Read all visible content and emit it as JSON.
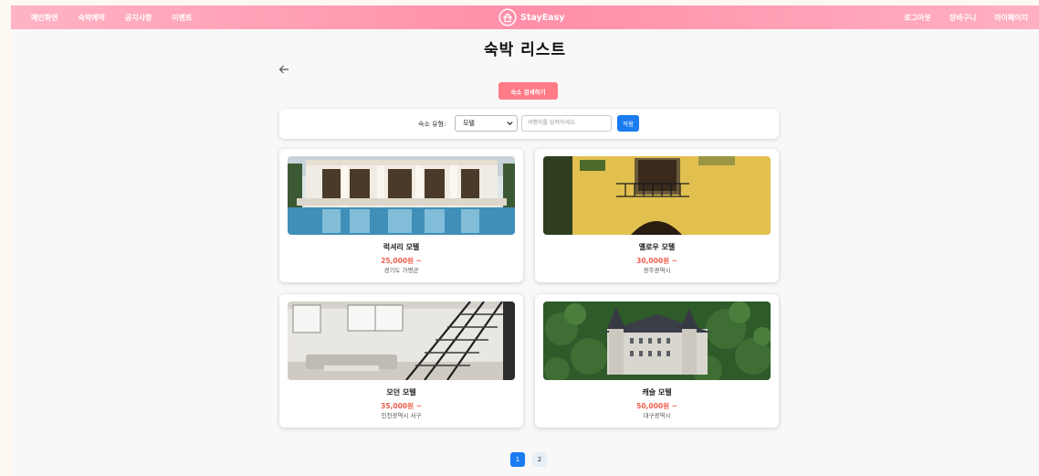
{
  "nav": {
    "left_items": [
      "메인화면",
      "숙박예약",
      "공지사항",
      "이벤트"
    ],
    "brand": "StayEasy",
    "right_items": [
      "로그아웃",
      "장바구니",
      "마이페이지"
    ]
  },
  "page_title": "숙박 리스트",
  "search_button": "숙소 검색하기",
  "filter": {
    "type_label": "숙소 유형:",
    "type_value": "모텔",
    "location_placeholder": "여행지를 입력하세요.",
    "apply_label": "적용"
  },
  "listings": [
    {
      "name": "럭셔리 모텔",
      "price": "25,000원 ~",
      "location": "경기도 가평군"
    },
    {
      "name": "옐로우 모텔",
      "price": "30,000원 ~",
      "location": "광주광역시"
    },
    {
      "name": "모던 모텔",
      "price": "35,000원 ~",
      "location": "인천광역시 서구"
    },
    {
      "name": "캐슬 모텔",
      "price": "50,000원 ~",
      "location": "대구광역시"
    }
  ],
  "pagination": {
    "pages": [
      "1",
      "2"
    ],
    "current": "1"
  },
  "colors": {
    "nav_gradient": "#ff8fa8",
    "search_button": "#ff7b86",
    "price": "#ef5d4d",
    "primary_blue": "#1a7cf0"
  },
  "icons": {
    "back": "arrow-left-icon",
    "brand": "home-logo-icon",
    "select": "chevron-down-icon"
  }
}
